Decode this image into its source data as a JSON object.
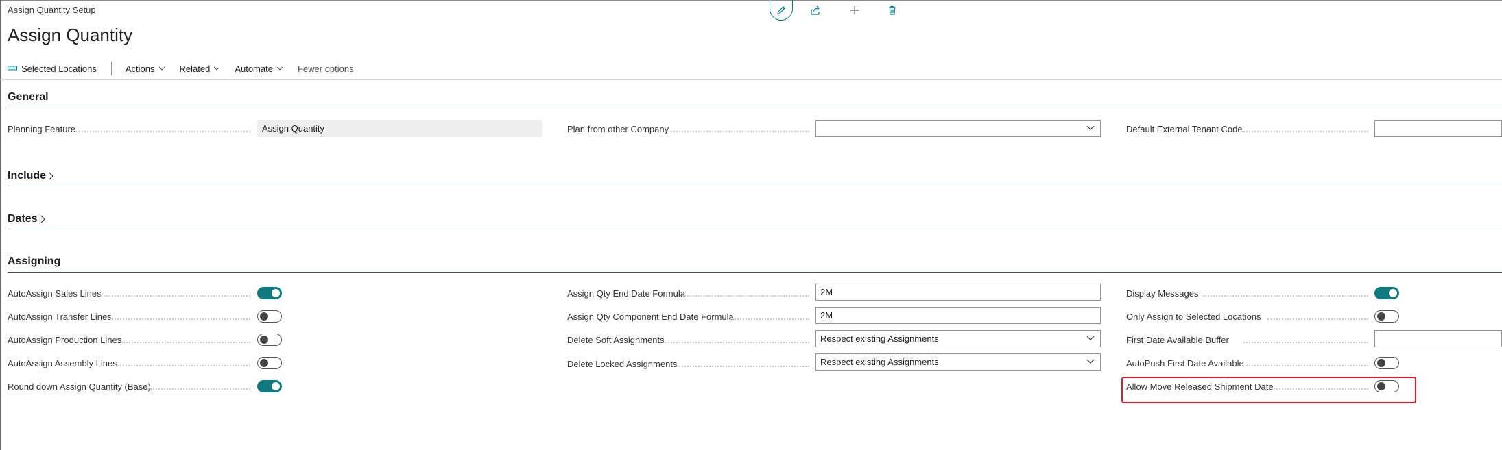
{
  "header": {
    "caption": "Assign Quantity Setup",
    "title": "Assign Quantity"
  },
  "top_actions": {
    "edit": "pencil-icon",
    "share": "share-icon",
    "add": "plus-icon",
    "delete": "trash-icon",
    "accent": "#0a7c86"
  },
  "actionbar": {
    "selected_locations": "Selected Locations",
    "actions": "Actions",
    "related": "Related",
    "automate": "Automate",
    "fewer_options": "Fewer options"
  },
  "sections": {
    "general": "General",
    "include": "Include",
    "dates": "Dates",
    "assigning": "Assigning"
  },
  "general": {
    "planning_feature_label": "Planning Feature",
    "planning_feature_value": "Assign Quantity",
    "plan_from_other_company_label": "Plan from other Company",
    "plan_from_other_company_value": "",
    "default_external_tenant_code_label": "Default External Tenant Code",
    "default_external_tenant_code_value": ""
  },
  "assigning": {
    "col1": [
      {
        "label": "AutoAssign Sales Lines",
        "on": true
      },
      {
        "label": "AutoAssign Transfer Lines",
        "on": false
      },
      {
        "label": "AutoAssign Production Lines",
        "on": false
      },
      {
        "label": "AutoAssign Assembly Lines",
        "on": false
      },
      {
        "label": "Round down Assign Quantity (Base)",
        "on": true
      }
    ],
    "col2": [
      {
        "label": "Assign Qty End Date Formula",
        "value": "2M"
      },
      {
        "label": "Assign Qty Component End Date Formula",
        "value": "2M"
      },
      {
        "label": "Delete Soft Assignments",
        "value": "Respect existing Assignments"
      },
      {
        "label": "Delete Locked Assignments",
        "value": "Respect existing Assignments"
      }
    ],
    "col3": [
      {
        "label": "Display Messages",
        "on": true
      },
      {
        "label": "Only Assign to Selected Locations",
        "on": false
      },
      {
        "label": "First Date Available Buffer",
        "value": ""
      },
      {
        "label": "AutoPush First Date Available",
        "on": false
      },
      {
        "label": "Allow Move Released Shipment Date",
        "on": false
      }
    ]
  },
  "colors": {
    "toggle_on": "#0f7a80",
    "highlight": "#e0192d"
  }
}
